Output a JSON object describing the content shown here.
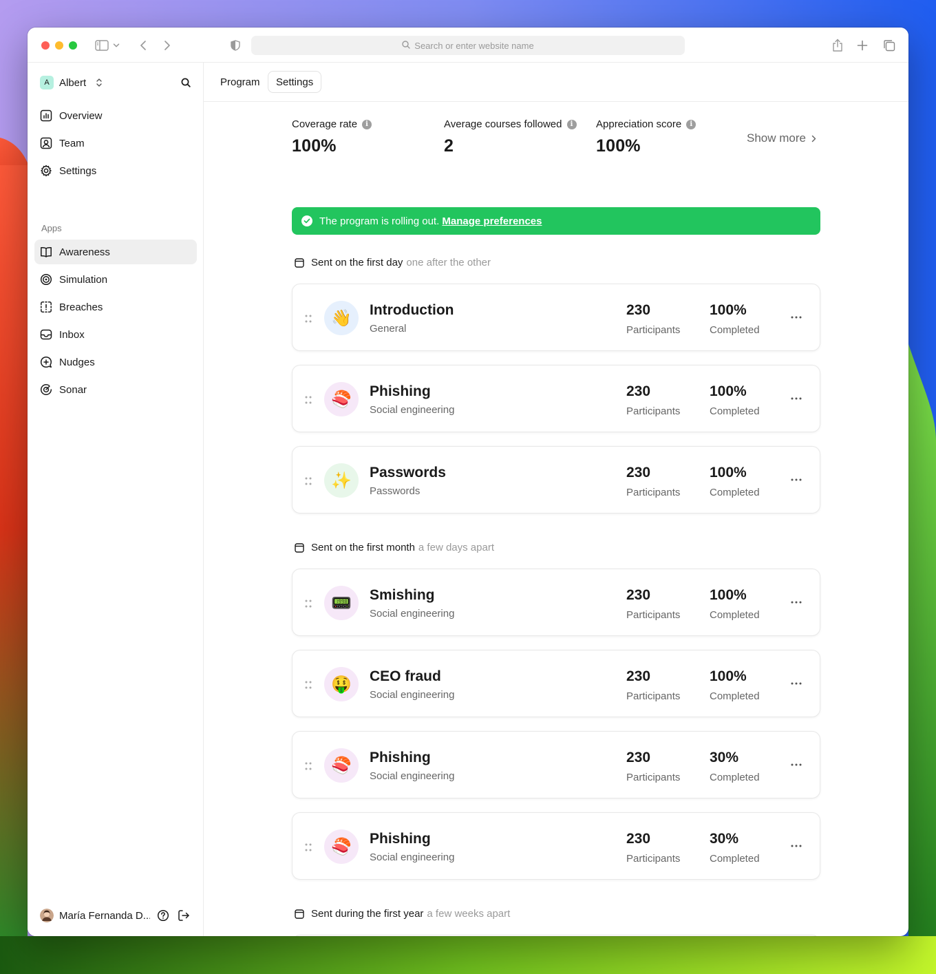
{
  "browser": {
    "url_placeholder": "Search or enter website name"
  },
  "sidebar": {
    "workspace": {
      "initial": "A",
      "name": "Albert"
    },
    "nav_items": [
      {
        "label": "Overview",
        "icon": "chart-icon"
      },
      {
        "label": "Team",
        "icon": "user-square-icon"
      },
      {
        "label": "Settings",
        "icon": "gear-icon"
      }
    ],
    "apps_label": "Apps",
    "app_items": [
      {
        "label": "Awareness",
        "icon": "book-icon",
        "active": true
      },
      {
        "label": "Simulation",
        "icon": "target-icon"
      },
      {
        "label": "Breaches",
        "icon": "breach-icon"
      },
      {
        "label": "Inbox",
        "icon": "inbox-icon"
      },
      {
        "label": "Nudges",
        "icon": "nudge-icon"
      },
      {
        "label": "Sonar",
        "icon": "sonar-icon"
      }
    ],
    "user": {
      "name": "María Fernanda D..."
    }
  },
  "tabs": {
    "program": "Program",
    "settings": "Settings"
  },
  "stats": [
    {
      "label": "Coverage rate",
      "value": "100%"
    },
    {
      "label": "Average courses followed",
      "value": "2"
    },
    {
      "label": "Appreciation score",
      "value": "100%"
    }
  ],
  "show_more": "Show more",
  "banner": {
    "text": "The program is rolling out.",
    "link": "Manage preferences",
    "color": "#22c55e"
  },
  "sections": [
    {
      "title": "Sent on the first day",
      "subtitle": "one after the other",
      "courses": [
        {
          "emoji": "👋",
          "bg": "#e6f0fd",
          "title": "Introduction",
          "category": "General",
          "participants": "230",
          "participants_label": "Participants",
          "completed": "100%",
          "completed_label": "Completed"
        },
        {
          "emoji": "🍣",
          "bg": "#f6e8f8",
          "title": "Phishing",
          "category": "Social engineering",
          "participants": "230",
          "participants_label": "Participants",
          "completed": "100%",
          "completed_label": "Completed"
        },
        {
          "emoji": "✨",
          "bg": "#e8f7ea",
          "title": "Passwords",
          "category": "Passwords",
          "participants": "230",
          "participants_label": "Participants",
          "completed": "100%",
          "completed_label": "Completed"
        }
      ]
    },
    {
      "title": "Sent on the first month",
      "subtitle": "a few days apart",
      "courses": [
        {
          "emoji": "📟",
          "bg": "#f6e8f8",
          "title": "Smishing",
          "category": "Social engineering",
          "participants": "230",
          "participants_label": "Participants",
          "completed": "100%",
          "completed_label": "Completed"
        },
        {
          "emoji": "🤑",
          "bg": "#f6e8f8",
          "title": "CEO fraud",
          "category": "Social engineering",
          "participants": "230",
          "participants_label": "Participants",
          "completed": "100%",
          "completed_label": "Completed"
        },
        {
          "emoji": "🍣",
          "bg": "#f6e8f8",
          "title": "Phishing",
          "category": "Social engineering",
          "participants": "230",
          "participants_label": "Participants",
          "completed": "30%",
          "completed_label": "Completed"
        },
        {
          "emoji": "🍣",
          "bg": "#f6e8f8",
          "title": "Phishing",
          "category": "Social engineering",
          "participants": "230",
          "participants_label": "Participants",
          "completed": "30%",
          "completed_label": "Completed"
        }
      ]
    },
    {
      "title": "Sent during the first year",
      "subtitle": "a few weeks apart",
      "courses": []
    }
  ]
}
